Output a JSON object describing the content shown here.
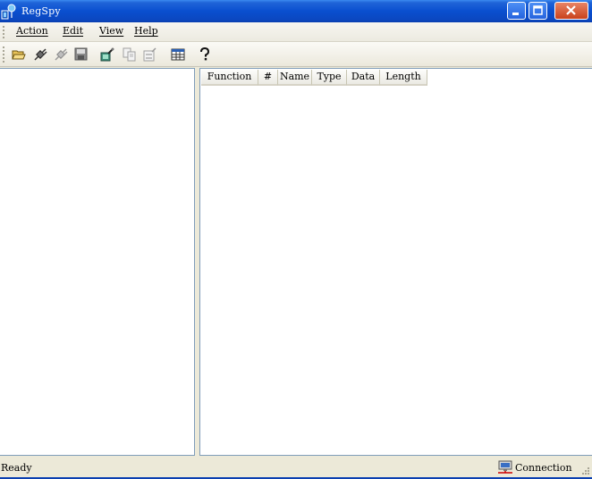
{
  "window": {
    "title": "RegSpy"
  },
  "menu": {
    "action": "Action",
    "edit": "Edit",
    "view": "View",
    "help": "Help"
  },
  "toolbar": {
    "icons": [
      "open-folder-icon",
      "connect-icon",
      "disconnect-icon",
      "save-icon",
      "options-icon",
      "copy-icon",
      "properties-icon",
      "view-grid-icon",
      "help-icon"
    ]
  },
  "list": {
    "columns": [
      "Function",
      "#",
      "Name",
      "Type",
      "Data",
      "Length"
    ]
  },
  "status": {
    "text": "Ready",
    "connection": "Connection"
  },
  "colors": {
    "titlebar": "#0a4fcf",
    "close_button": "#c9421c",
    "pane_border": "#7f9db9"
  }
}
